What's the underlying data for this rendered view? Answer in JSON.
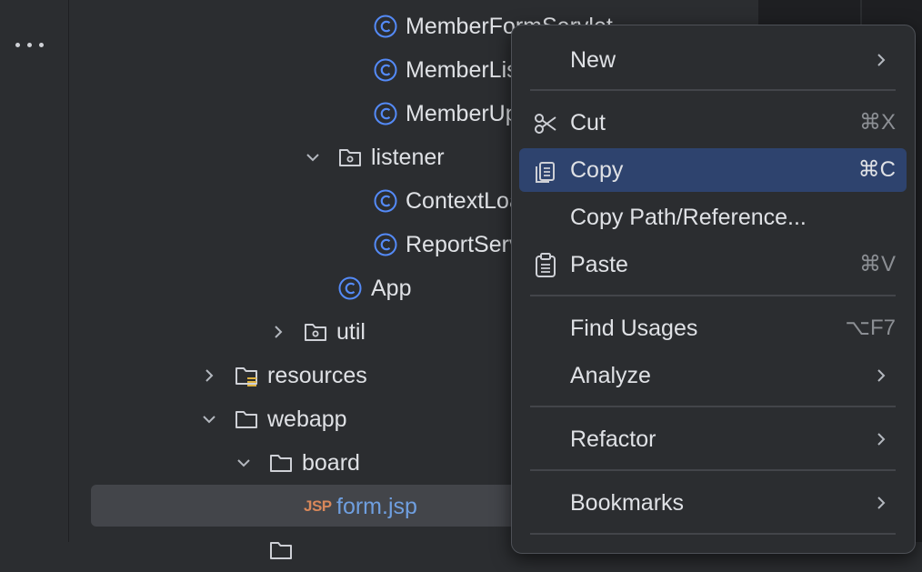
{
  "sidebar": {
    "more_icon": "more-horizontal-icon"
  },
  "tree": {
    "items": [
      {
        "label": "MemberFormServlet",
        "icon": "class-icon"
      },
      {
        "label": "MemberListServlet",
        "icon": "class-icon"
      },
      {
        "label": "MemberUpdateServlet",
        "icon": "class-icon"
      },
      {
        "label": "listener",
        "icon": "package-folder-icon",
        "expanded": true
      },
      {
        "label": "ContextLoaderListener",
        "icon": "class-icon"
      },
      {
        "label": "ReportServlet",
        "icon": "class-icon"
      },
      {
        "label": "App",
        "icon": "class-icon"
      },
      {
        "label": "util",
        "icon": "package-folder-icon",
        "expanded": false
      },
      {
        "label": "resources",
        "icon": "resources-folder-icon",
        "expanded": false
      },
      {
        "label": "webapp",
        "icon": "folder-icon",
        "expanded": true
      },
      {
        "label": "board",
        "icon": "folder-icon",
        "expanded": true
      },
      {
        "label": "form.jsp",
        "icon": "jsp-file-icon",
        "icon_text": "JSP",
        "selected": true
      }
    ]
  },
  "context_menu": {
    "items": [
      {
        "label": "New",
        "submenu": true
      },
      {
        "label": "Cut",
        "shortcut": "⌘X",
        "icon": "scissors-icon"
      },
      {
        "label": "Copy",
        "shortcut": "⌘C",
        "icon": "copy-icon",
        "active": true
      },
      {
        "label": "Copy Path/Reference..."
      },
      {
        "label": "Paste",
        "shortcut": "⌘V",
        "icon": "clipboard-icon"
      },
      {
        "label": "Find Usages",
        "shortcut": "⌥F7"
      },
      {
        "label": "Analyze",
        "submenu": true
      },
      {
        "label": "Refactor",
        "submenu": true
      },
      {
        "label": "Bookmarks",
        "submenu": true
      }
    ]
  },
  "colors": {
    "background": "#2b2d30",
    "selection": "#43454a",
    "menu_highlight": "#2e436e",
    "class_icon": "#548af7",
    "jsp_icon": "#d8875a",
    "text": "#dfe1e5"
  }
}
